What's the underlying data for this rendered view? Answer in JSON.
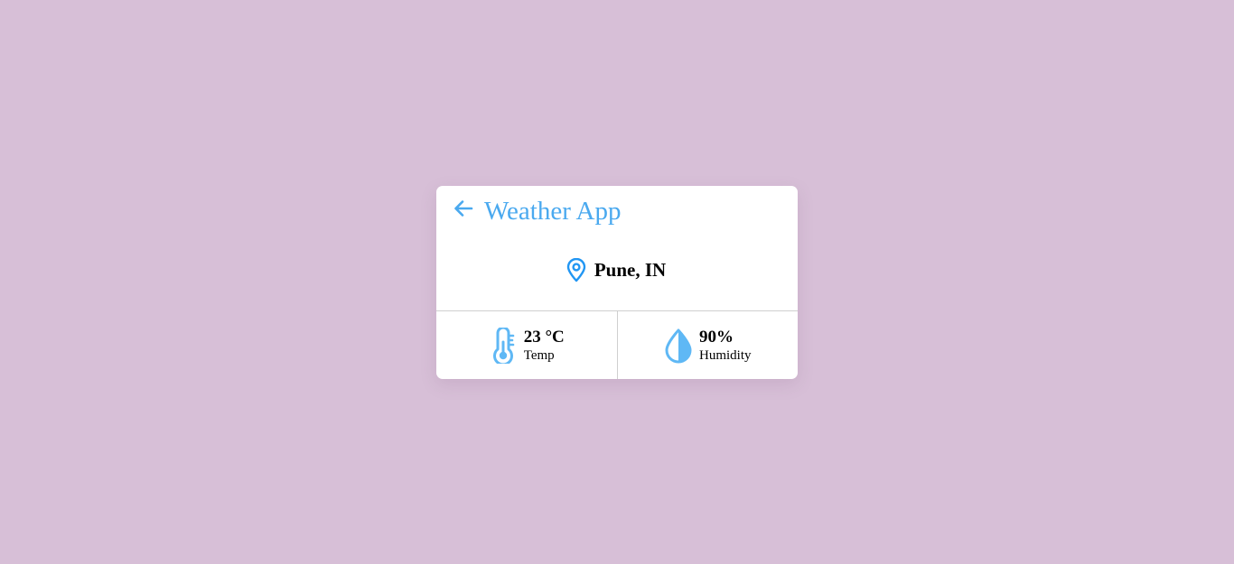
{
  "app": {
    "title": "Weather App"
  },
  "location": {
    "name": "Pune, IN"
  },
  "stats": {
    "temperature": {
      "value": "23 °C",
      "label": "Temp"
    },
    "humidity": {
      "value": "90%",
      "label": "Humidity"
    }
  },
  "icons": {
    "back": "arrow-left-icon",
    "location": "map-pin-icon",
    "temperature": "thermometer-icon",
    "humidity": "water-drop-icon"
  },
  "colors": {
    "background": "#d7bfd7",
    "accent": "#4aa9ef",
    "pin": "#2196f3",
    "icon_light": "#5fb8f5",
    "card": "#ffffff"
  }
}
